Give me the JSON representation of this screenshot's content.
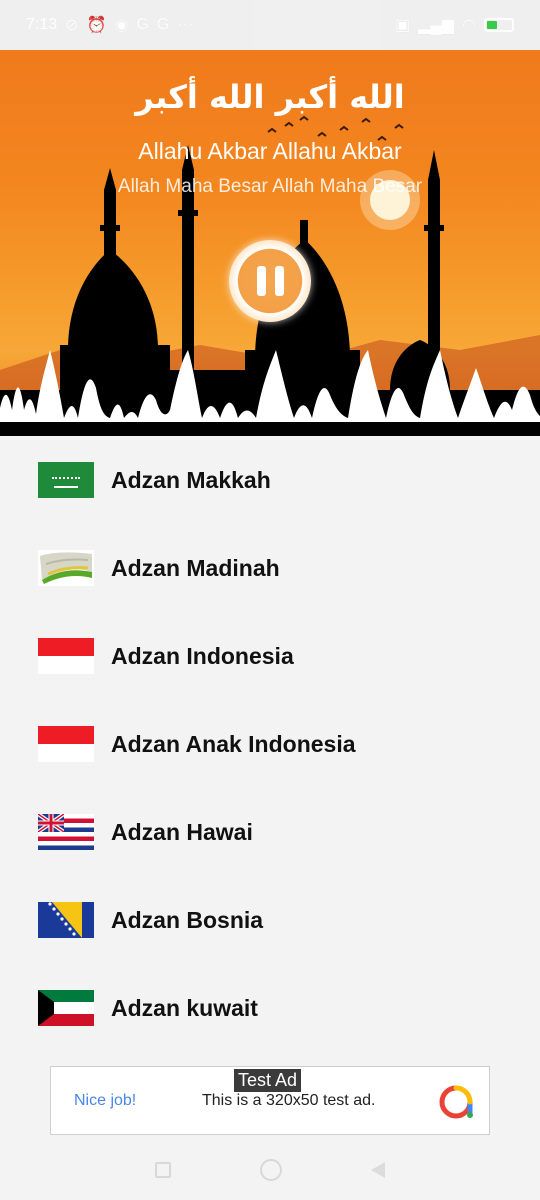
{
  "status_bar": {
    "time": "7:13",
    "left_icons": [
      "no-signal-icon",
      "alarm-icon",
      "app-icon",
      "google-icon",
      "google-icon",
      "more-icon"
    ],
    "right_icons": [
      "vpn-icon",
      "signal-icon",
      "wifi-icon",
      "battery-icon"
    ]
  },
  "hero": {
    "arabic": "الله أكبر الله أكبر",
    "transliteration": "Allahu Akbar Allahu Akbar",
    "meaning": "Allah Maha Besar Allah Maha Besar",
    "playback_state": "playing"
  },
  "list": [
    {
      "label": "Adzan Makkah",
      "flag": "saudi-arabia-flag"
    },
    {
      "label": "Adzan Madinah",
      "flag": "madinah-flag"
    },
    {
      "label": "Adzan Indonesia",
      "flag": "indonesia-flag"
    },
    {
      "label": "Adzan Anak Indonesia",
      "flag": "indonesia-flag"
    },
    {
      "label": "Adzan Hawai",
      "flag": "hawaii-flag"
    },
    {
      "label": "Adzan Bosnia",
      "flag": "bosnia-flag"
    },
    {
      "label": "Adzan kuwait",
      "flag": "kuwait-flag"
    }
  ],
  "ad": {
    "badge": "Test Ad",
    "headline": "Nice job!",
    "body": "This is a 320x50 test ad.",
    "logo": "admob-logo"
  },
  "colors": {
    "hero_orange": "#f07a1c",
    "ad_link": "#4a86e8",
    "text": "#111111"
  }
}
